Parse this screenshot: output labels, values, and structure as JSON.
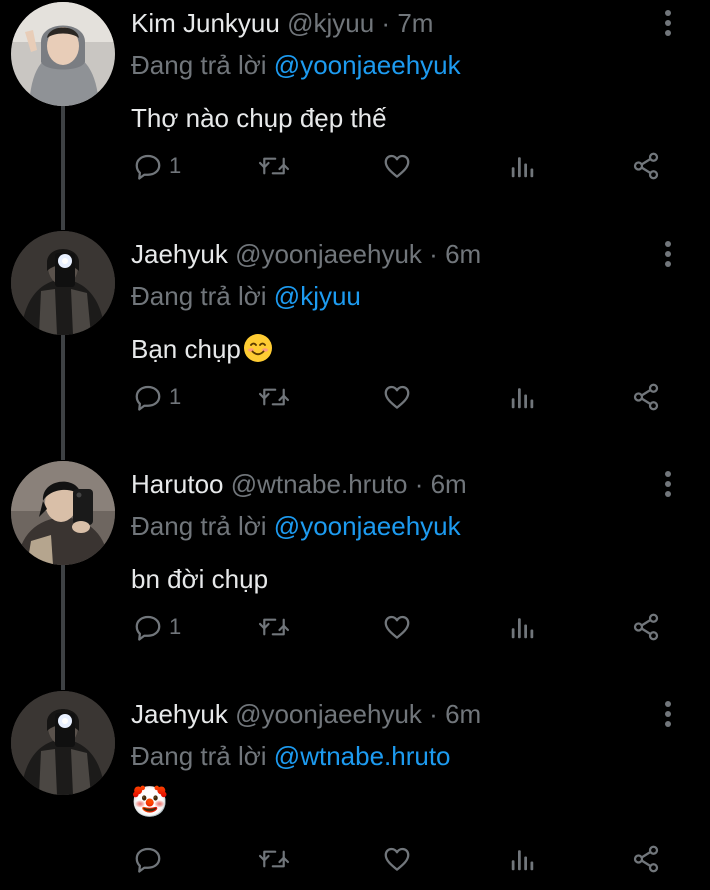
{
  "replies": [
    {
      "display_name": "Kim Junkyuu",
      "handle": "@kjyuu",
      "separator": "·",
      "time": "7m",
      "reply_prefix": "Đang trả lời",
      "reply_to": "@yoonjaeehyuk",
      "text": "Thợ nào chụp đẹp thế",
      "reply_count": "1"
    },
    {
      "display_name": "Jaehyuk",
      "handle": "@yoonjaeehyuk",
      "separator": "·",
      "time": "6m",
      "reply_prefix": "Đang trả lời",
      "reply_to": "@kjyuu",
      "text": "Bạn chụp",
      "reply_count": "1"
    },
    {
      "display_name": "Harutoo",
      "handle": "@wtnabe.hruto",
      "separator": "·",
      "time": "6m",
      "reply_prefix": "Đang trả lời",
      "reply_to": "@yoonjaeehyuk",
      "text": "bn đời chụp",
      "reply_count": "1"
    },
    {
      "display_name": "Jaehyuk",
      "handle": "@yoonjaeehyuk",
      "separator": "·",
      "time": "6m",
      "reply_prefix": "Đang trả lời",
      "reply_to": "@wtnabe.hruto",
      "text": "🤡",
      "reply_count": ""
    }
  ],
  "icons": {
    "reply": "speech-bubble-icon",
    "retweet": "retweet-icon",
    "like": "heart-icon",
    "views": "bar-chart-icon",
    "share": "share-nodes-icon",
    "more": "vertical-ellipsis-icon"
  },
  "colors": {
    "background": "#000000",
    "primary_text": "#e7e9ea",
    "secondary_text": "#71767b",
    "mention": "#1d9bf0",
    "thread_line": "#3e4144"
  }
}
